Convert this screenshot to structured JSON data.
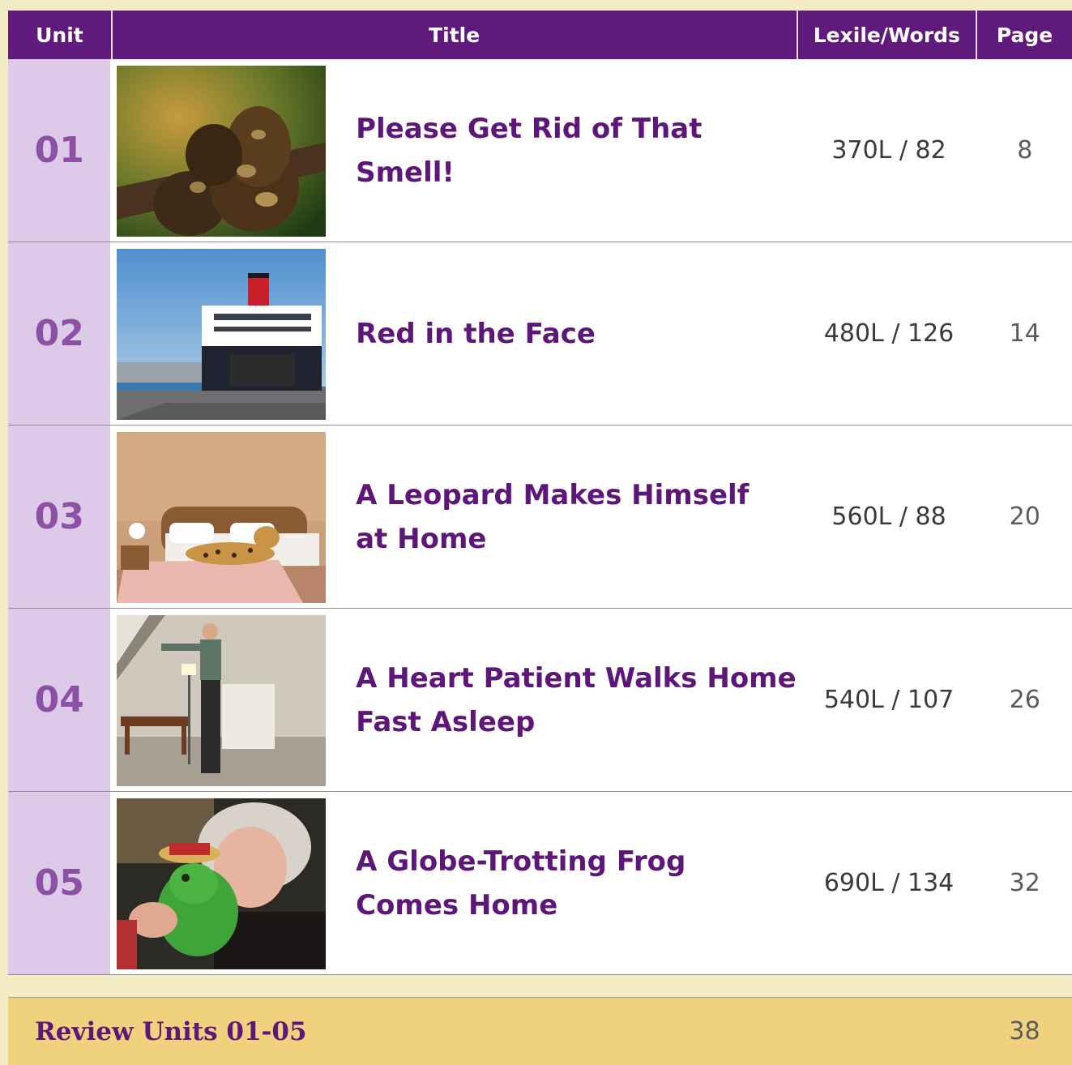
{
  "header": {
    "unit": "Unit",
    "title": "Title",
    "lexile": "Lexile/Words",
    "page": "Page"
  },
  "rows": [
    {
      "unit": "01",
      "title": "Please Get Rid of That Smell!",
      "lexile": "370L / 82",
      "page": "8",
      "photo": "python-snake-photo"
    },
    {
      "unit": "02",
      "title": "Red in the Face",
      "lexile": "480L / 126",
      "page": "14",
      "photo": "ferry-ship-photo"
    },
    {
      "unit": "03",
      "title_line1": "A Leopard Makes Himself",
      "title_line2": "at Home",
      "lexile": "560L / 88",
      "page": "20",
      "photo": "leopard-bed-photo"
    },
    {
      "unit": "04",
      "title_line1": "A Heart Patient Walks Home",
      "title_line2": "Fast Asleep",
      "lexile": "540L / 107",
      "page": "26",
      "photo": "sleepwalker-photo"
    },
    {
      "unit": "05",
      "title_line1": "A Globe-Trotting Frog",
      "title_line2": "Comes Home",
      "lexile": "690L / 134",
      "page": "32",
      "photo": "frog-woman-photo"
    }
  ],
  "review": {
    "label": "Review Units 01-05",
    "page": "38"
  },
  "colors": {
    "header_bg": "#5f1a7c",
    "unit_bg": "#ddc9e8",
    "unit_text": "#8d51a4",
    "title_text": "#5d1778",
    "review_bg": "#f0d27e"
  }
}
